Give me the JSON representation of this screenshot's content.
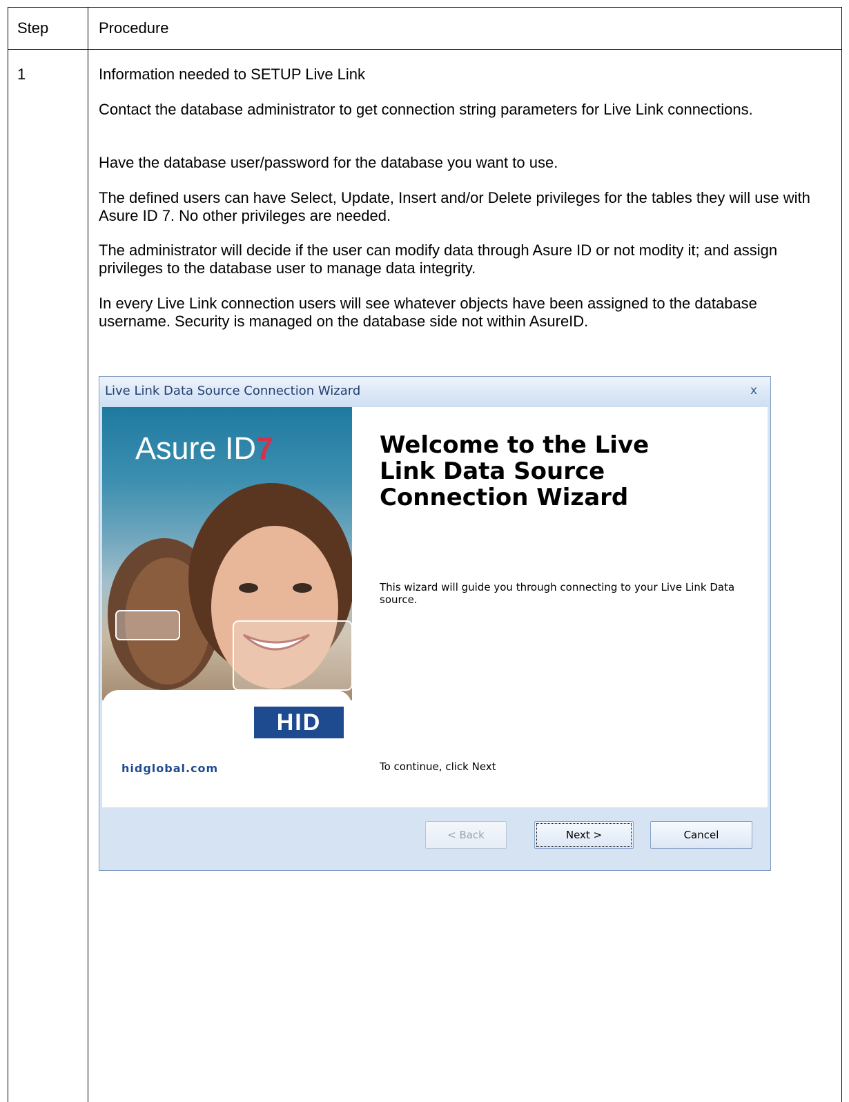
{
  "table": {
    "header": {
      "step": "Step",
      "procedure": "Procedure"
    },
    "rows": [
      {
        "step": "1",
        "paragraphs": [
          "Information needed to SETUP Live Link",
          "Contact the database administrator to get connection string parameters for Live Link connections.",
          "Have the database user/password for the database you want to use.",
          "The defined users can have Select, Update, Insert and/or Delete privileges for the tables they will use with Asure ID 7. No other privileges are needed.",
          "The administrator will decide if the user can modify data through Asure ID or not modity it; and assign privileges to the database user to manage data integrity.",
          "In every Live Link connection users will see whatever objects have been assigned to the database username. Security is managed on the database side not within AsureID."
        ]
      }
    ]
  },
  "wizard": {
    "title": "Live Link Data Source Connection Wizard",
    "close_glyph": "x",
    "banner": {
      "product": "Asure ID",
      "version": "7",
      "brand": "HID",
      "website": "hidglobal.com"
    },
    "heading": "Welcome to the Live Link Data Source Connection Wizard",
    "description": "This wizard will guide you through connecting to your Live Link Data source.",
    "continue_hint": "To continue, click Next",
    "buttons": {
      "back": "< Back",
      "next": "Next >",
      "cancel": "Cancel"
    }
  },
  "colors": {
    "titlebar_text": "#23406f",
    "brand_blue": "#1e4b8f",
    "accent_red": "#d0344c"
  }
}
